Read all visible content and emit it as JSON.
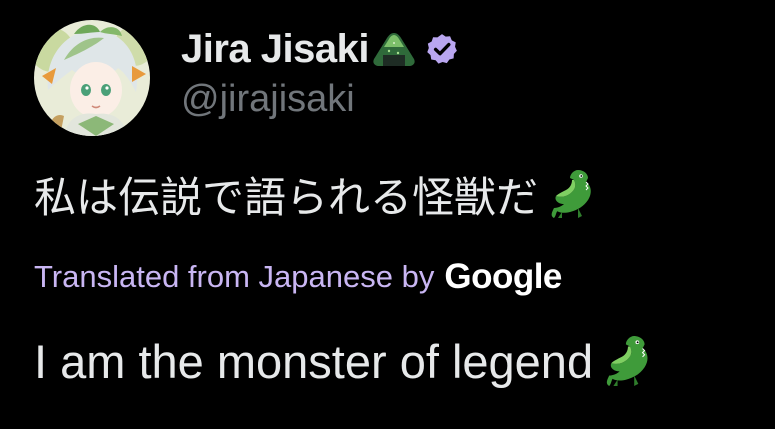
{
  "author": {
    "display_name": "Jira Jisaki",
    "handle": "@jirajisaki",
    "name_emoji": "onigiri-emoji",
    "verified_icon": "verified-badge-icon",
    "verified_color": "#b9a6f0"
  },
  "tweet": {
    "original_text": "私は伝説で語られる怪獣だ",
    "original_emoji": "crocodile-emoji",
    "translation_label": "Translated from Japanese by",
    "translation_provider": "Google",
    "translated_text": "I am the monster of legend",
    "translated_emoji": "crocodile-emoji"
  },
  "colors": {
    "background": "#000000",
    "primary_text": "#e7e9ea",
    "secondary_text": "#71767b",
    "translation_label": "#c9b6f3"
  }
}
